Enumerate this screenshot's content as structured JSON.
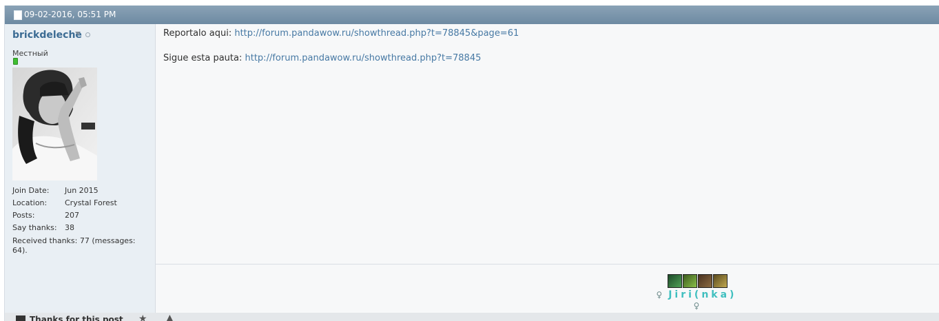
{
  "post": {
    "date": "09-02-2016, 05:51 PM",
    "document_icon": "document-icon"
  },
  "user": {
    "name": "brickdeleche",
    "title": "Местный",
    "menu_icon": "caret-down-icon",
    "status_icon": "offline-dot-icon",
    "stats": [
      {
        "label": "Join Date:",
        "value": "Jun 2015"
      },
      {
        "label": "Location:",
        "value": "Crystal Forest"
      },
      {
        "label": "Posts:",
        "value": "207"
      },
      {
        "label": "Say thanks:",
        "value": "38"
      }
    ],
    "received_thanks": "Received thanks: 77 (messages: 64)."
  },
  "message": {
    "line1_text": "Reportalo aqui: ",
    "line1_link": "http://forum.pandawow.ru/showthread.php?t=78845&page=61",
    "line2_text": "Sigue esta pauta: ",
    "line2_link": "http://forum.pandawow.ru/showthread.php?t=78845"
  },
  "signature": {
    "name": "Jiri(nka)",
    "pin_symbol": "♀",
    "icon_colors": [
      "#2a6a3a",
      "#4b8a2a",
      "#6a4a2a",
      "#8a7a3a"
    ]
  },
  "footer": {
    "thanks_label": "Thanks for this post",
    "star_icon": "star-icon",
    "up_icon": "arrow-up-icon"
  }
}
